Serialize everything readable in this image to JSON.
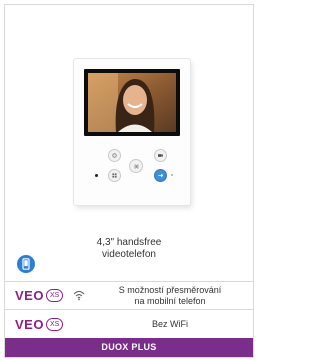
{
  "product": {
    "caption_line1": "4,3\" handsfree",
    "caption_line2": "videotelefon"
  },
  "features": [
    {
      "logo_main": "VEO",
      "logo_sub": "XS",
      "icon": "wifi-icon",
      "text_line1": "S možností přesměrování",
      "text_line2": "na mobilní telefon"
    },
    {
      "logo_main": "VEO",
      "logo_sub": "XS",
      "text": "Bez WiFi"
    }
  ],
  "footer": {
    "label": "DUOX PLUS"
  },
  "colors": {
    "brand": "#8b1f86",
    "footer_bar": "#7b2d8a",
    "accent_blue": "#2b7fd4"
  },
  "icons": {
    "badge": "smartphone-icon",
    "device_buttons": [
      "key-icon",
      "intercom-icon",
      "camera-icon",
      "menu-icon",
      "door-open-icon"
    ]
  }
}
